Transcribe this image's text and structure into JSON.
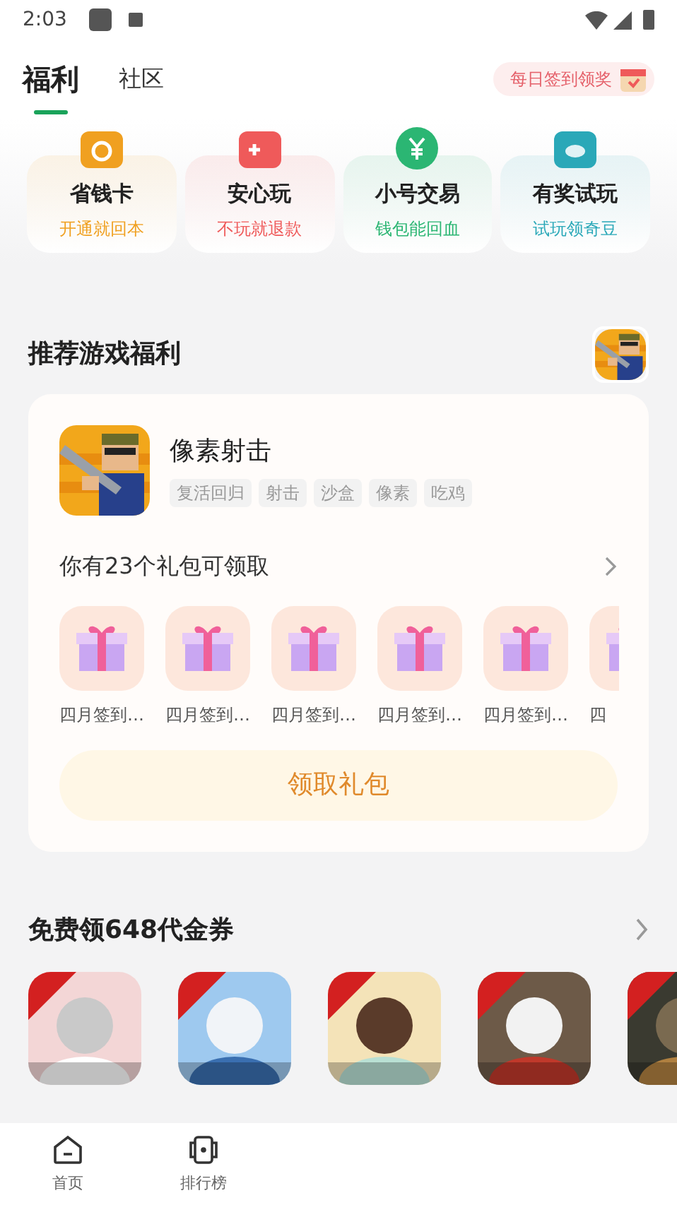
{
  "status_bar": {
    "time": "2:03"
  },
  "tabs": [
    {
      "label": "福利",
      "selected": true
    },
    {
      "label": "社区",
      "selected": false
    }
  ],
  "checkin_button": "每日签到领奖",
  "feature_cards": [
    {
      "title": "省钱卡",
      "subtitle": "开通就回本",
      "color": "#f0a020"
    },
    {
      "title": "安心玩",
      "subtitle": "不玩就退款",
      "color": "#ef5a5a"
    },
    {
      "title": "小号交易",
      "subtitle": "钱包能回血",
      "color": "#2bb673"
    },
    {
      "title": "有奖试玩",
      "subtitle": "试玩领奇豆",
      "color": "#2aa8b8"
    }
  ],
  "recommend": {
    "title": "推荐游戏福利",
    "game": {
      "name": "像素射击",
      "tags": [
        "复活回归",
        "射击",
        "沙盒",
        "像素",
        "吃鸡"
      ]
    },
    "gift_count": "你有23个礼包可领取",
    "gifts": [
      {
        "label": "四月签到…"
      },
      {
        "label": "四月签到…"
      },
      {
        "label": "四月签到…"
      },
      {
        "label": "四月签到…"
      },
      {
        "label": "四月签到…"
      },
      {
        "label": "四"
      }
    ],
    "claim_button": "领取礼包"
  },
  "vouchers": {
    "title": "免费领648代金券"
  },
  "bottom_nav": [
    {
      "label": "首页",
      "kind": "home"
    },
    {
      "label": "排行榜",
      "kind": "rank"
    }
  ]
}
